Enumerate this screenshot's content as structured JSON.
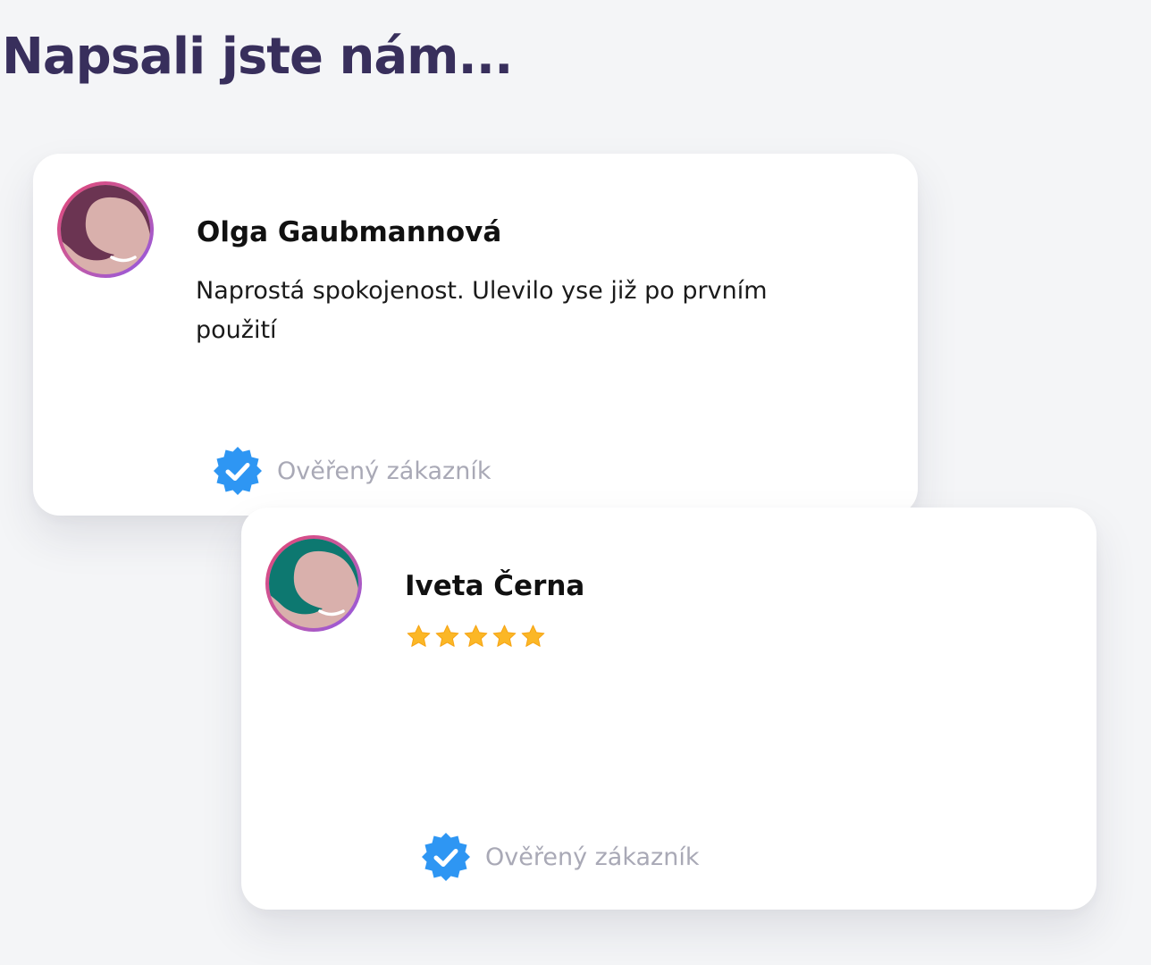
{
  "section": {
    "title": "Napsali jste nám..."
  },
  "reviews": [
    {
      "name": "Olga Gaubmannová",
      "text": "Naprostá spokojenost. Ulevilo yse již po prvním použití",
      "verified_label": "Ověřený zákazník",
      "avatar_hair_color": "#6b3452"
    },
    {
      "name": "Iveta Černa",
      "rating": 5,
      "rating_max": 5,
      "verified_label": "Ověřený zákazník",
      "avatar_hair_color": "#0d7870"
    }
  ],
  "colors": {
    "title": "#382f5c",
    "verified_badge": "#2e96f3",
    "star": "#fbb726",
    "avatar_ring_start": "#e0457a",
    "avatar_ring_end": "#8e58e8",
    "skin": "#d9b0ac"
  }
}
